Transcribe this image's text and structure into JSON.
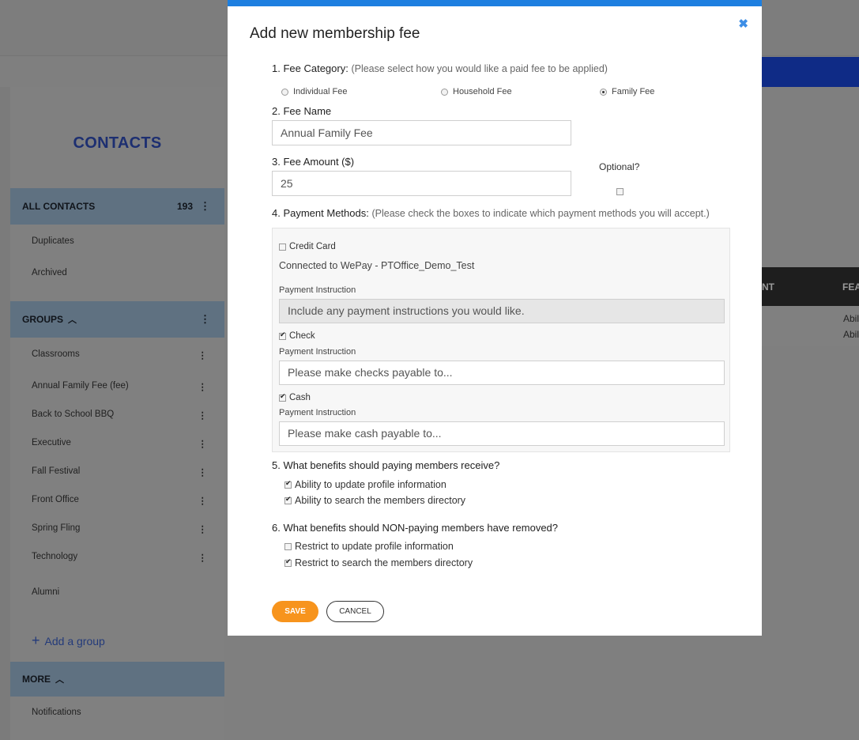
{
  "background": {
    "sidebar": {
      "title": "CONTACTS",
      "all_contacts": {
        "label": "ALL CONTACTS",
        "count": "193"
      },
      "contacts_items": [
        "Duplicates",
        "Archived"
      ],
      "groups_header": "GROUPS",
      "groups": [
        "Classrooms",
        "Annual Family Fee (fee)",
        "Back to School BBQ",
        "Executive",
        "Fall Festival",
        "Front Office",
        "Spring Fling",
        "Technology"
      ],
      "alumni": "Alumni",
      "add_group": "Add a group",
      "more_header": "MORE",
      "more_items": [
        "Notifications"
      ]
    },
    "table": {
      "head_1": "NT",
      "head_2": "FEA",
      "row_1": "Abil",
      "row_2": "Abil"
    }
  },
  "modal": {
    "title": "Add new membership fee",
    "close_icon": "close-icon",
    "fee_category": {
      "label": "1. Fee Category:",
      "hint": "(Please select how you would like a paid fee to be applied)",
      "options": [
        "Individual Fee",
        "Household Fee",
        "Family Fee"
      ],
      "selected": "Family Fee"
    },
    "fee_name": {
      "label": "2. Fee Name",
      "value": "Annual Family Fee"
    },
    "fee_amount": {
      "label": "3. Fee Amount ($)",
      "value": "25",
      "optional_label": "Optional?"
    },
    "payment_methods": {
      "label": "4. Payment Methods:",
      "hint": "(Please check the boxes to indicate which payment methods you will accept.)",
      "credit_card": {
        "label": "Credit Card",
        "connected": "Connected to WePay - PTOffice_Demo_Test",
        "instruction_label": "Payment Instruction",
        "placeholder": "Include any payment instructions you would like."
      },
      "check": {
        "label": "Check",
        "instruction_label": "Payment Instruction",
        "placeholder": "Please make checks payable to..."
      },
      "cash": {
        "label": "Cash",
        "instruction_label": "Payment Instruction",
        "placeholder": "Please make cash payable to..."
      }
    },
    "paying_benefits": {
      "label": "5. What benefits should paying members receive?",
      "items": [
        "Ability to update profile information",
        "Ability to search the members directory"
      ]
    },
    "nonpaying_removed": {
      "label": "6. What benefits should NON-paying members have removed?",
      "items": [
        "Restrict to update profile information",
        "Restrict to search the members directory"
      ]
    },
    "save_label": "SAVE",
    "cancel_label": "CANCEL"
  },
  "colors": {
    "accent_blue": "#1d7fe0",
    "save_orange": "#f7941d",
    "navy": "#0f2b86"
  }
}
